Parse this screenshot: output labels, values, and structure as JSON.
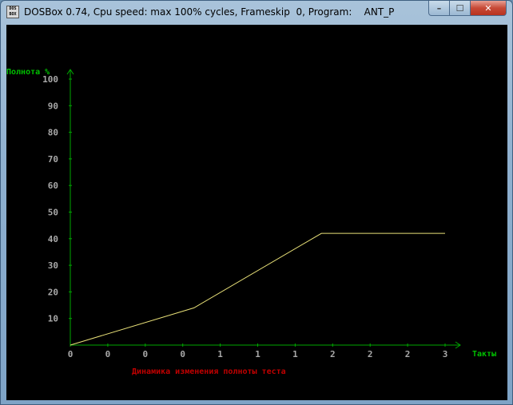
{
  "window": {
    "title": "DOSBox 0.74, Cpu speed: max 100% cycles, Frameskip  0, Program:    ANT_P",
    "icon_label_top": "DOS",
    "icon_label_bottom": "BOX",
    "minimize_glyph": "–",
    "maximize_glyph": "☐",
    "close_glyph": "✕"
  },
  "colors": {
    "axis": "#00a800",
    "axis_label": "#00c000",
    "tick_label": "#a8a8a8",
    "line": "#e8e078",
    "chart_title": "#c00000"
  },
  "chart_data": {
    "type": "line",
    "title": "Динамика изменения полноты теста",
    "ylabel": "Полнота %",
    "xlabel": "Такты",
    "ylim": [
      0,
      100
    ],
    "y_ticks": [
      "10",
      "20",
      "30",
      "40",
      "50",
      "60",
      "70",
      "80",
      "90",
      "100"
    ],
    "x_tick_labels": [
      "0",
      "0",
      "0",
      "0",
      "1",
      "1",
      "1",
      "2",
      "2",
      "2",
      "3"
    ],
    "x_range": [
      0,
      10
    ],
    "series": [
      {
        "x": [
          0,
          3.3,
          6.7,
          10
        ],
        "y": [
          0,
          14,
          42,
          42
        ]
      }
    ]
  }
}
